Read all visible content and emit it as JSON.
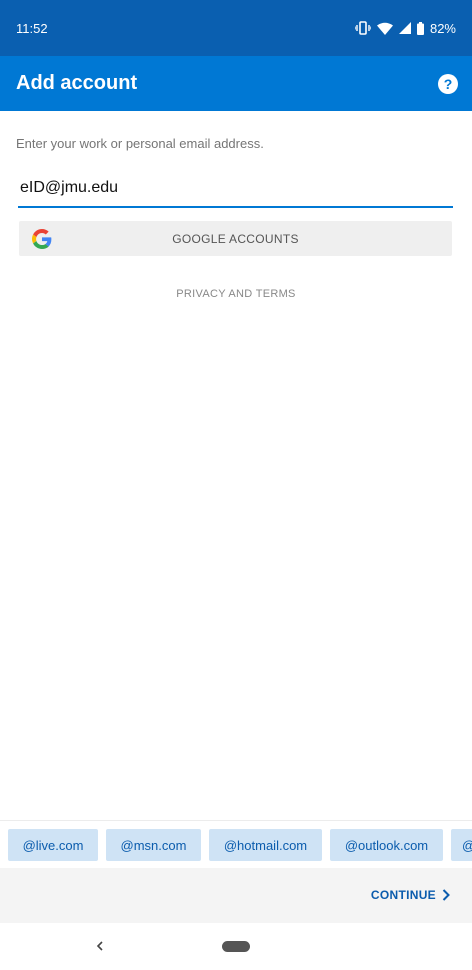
{
  "status_bar": {
    "time": "11:52",
    "battery": "82%",
    "icons": [
      "vibrate-icon",
      "wifi-icon",
      "signal-icon",
      "battery-icon"
    ]
  },
  "app_bar": {
    "title": "Add account",
    "help_icon": "question-mark-icon",
    "help_glyph": "?"
  },
  "form": {
    "prompt": "Enter your work or personal email address.",
    "email_value": "eID@jmu.edu",
    "google_button_label": "GOOGLE ACCOUNTS",
    "privacy_link": "PRIVACY AND TERMS"
  },
  "domain_suggestions": [
    "@live.com",
    "@msn.com",
    "@hotmail.com",
    "@outlook.com",
    "@"
  ],
  "bottom_bar": {
    "continue_label": "CONTINUE"
  },
  "colors": {
    "status_bar": "#0a5fb0",
    "app_bar": "#0078d4",
    "accent": "#0b5cad",
    "chip_bg": "#cfe3f5"
  }
}
